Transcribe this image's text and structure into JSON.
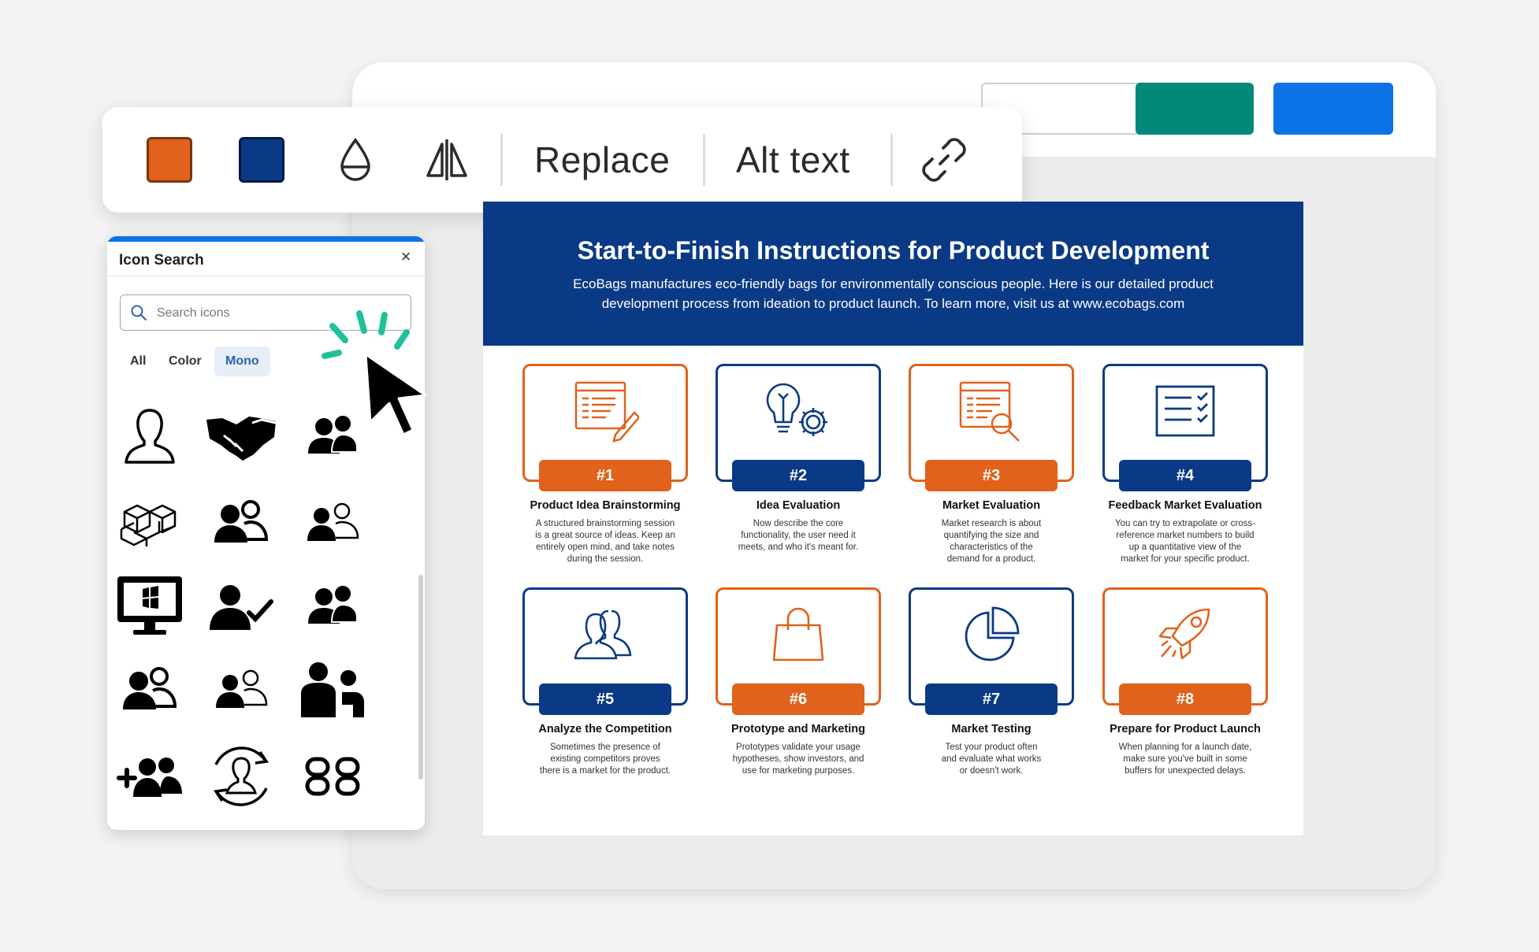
{
  "colors": {
    "orange": "#e0621c",
    "navy": "#0a3a85",
    "teal": "#028979",
    "blue": "#0b73e6",
    "spark": "#1fc19a"
  },
  "toolbar": {
    "items": [
      {
        "type": "swatch",
        "name": "orange-swatch",
        "color": "#e0621c"
      },
      {
        "type": "swatch",
        "name": "navy-swatch",
        "color": "#0a3a85"
      },
      {
        "type": "icon",
        "name": "opacity-drop-icon"
      },
      {
        "type": "icon",
        "name": "flip-horizontal-icon"
      },
      {
        "type": "text",
        "name": "replace-button"
      },
      {
        "type": "text",
        "name": "alt-text-button"
      },
      {
        "type": "icon",
        "name": "link-icon"
      }
    ],
    "replace_label": "Replace",
    "alt_text_label": "Alt text"
  },
  "icon_search": {
    "title": "Icon Search",
    "close_label": "×",
    "search_placeholder": "Search icons",
    "filters": [
      "All",
      "Color",
      "Mono"
    ],
    "active_filter": "Mono",
    "icons": [
      "person-outline-icon",
      "handshake-icon",
      "people-pair-icon",
      "boxes-icon",
      "user-group-icon",
      "user-group-outline-icon",
      "computer-monitor-icon",
      "user-check-icon",
      "user-pair-icon",
      "users-icon",
      "users-outline-icon",
      "user-family-icon",
      "add-users-icon",
      "user-refresh-icon",
      "chain-link-icon"
    ]
  },
  "infographic": {
    "title": "Start-to-Finish Instructions for Product Development",
    "subtitle_line1": "EcoBags manufactures eco-friendly bags for environmentally conscious people. Here is our detailed product",
    "subtitle_line2": "development process from ideation to product launch. To learn more, visit us at www.ecobags.com",
    "steps": [
      {
        "badge": "#1",
        "title": "Product Idea Brainstorming",
        "desc": [
          "A structured brainstorming session",
          "is a great source of ideas. Keep an",
          "entirely open mind, and take notes",
          "during the session."
        ],
        "color": "orange",
        "icon": "document-pencil-icon"
      },
      {
        "badge": "#2",
        "title": "Idea Evaluation",
        "desc": [
          "Now describe the core",
          "functionality, the user need it",
          "meets, and who it's meant for."
        ],
        "color": "navy",
        "icon": "lightbulb-gear-icon"
      },
      {
        "badge": "#3",
        "title": "Market Evaluation",
        "desc": [
          "Market research is about",
          "quantifying the size and",
          "characteristics of the",
          "demand for a product."
        ],
        "color": "orange",
        "icon": "document-search-icon"
      },
      {
        "badge": "#4",
        "title": "Feedback Market Evaluation",
        "desc": [
          "You can try to extrapolate or cross-",
          "reference market numbers to build",
          "up a quantitative view of the",
          "market for your specific product."
        ],
        "color": "navy",
        "icon": "checklist-icon"
      },
      {
        "badge": "#5",
        "title": "Analyze the Competition",
        "desc": [
          "Sometimes the presence of",
          "existing competitors proves",
          "there is a market for the product."
        ],
        "color": "navy",
        "icon": "two-people-icon"
      },
      {
        "badge": "#6",
        "title": "Prototype and Marketing",
        "desc": [
          "Prototypes validate your usage",
          "hypotheses, show investors, and",
          "use for marketing purposes."
        ],
        "color": "orange",
        "icon": "shopping-bag-icon"
      },
      {
        "badge": "#7",
        "title": "Market Testing",
        "desc": [
          "Test your product often",
          "and evaluate what works",
          "or doesn't work."
        ],
        "color": "navy",
        "icon": "pie-chart-icon"
      },
      {
        "badge": "#8",
        "title": "Prepare for Product Launch",
        "desc": [
          "When planning for a launch date,",
          "make sure you've built in some",
          "buffers for unexpected delays."
        ],
        "color": "orange",
        "icon": "rocket-icon"
      }
    ]
  }
}
